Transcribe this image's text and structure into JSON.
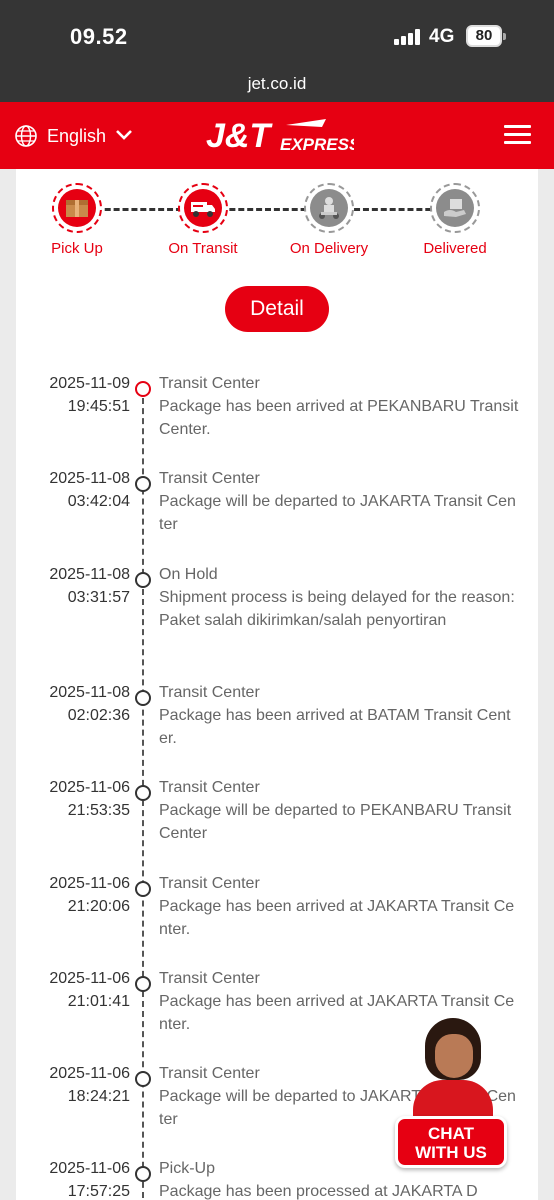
{
  "status_bar": {
    "time": "09.52",
    "network": "4G",
    "battery": "80",
    "url": "jet.co.id"
  },
  "header": {
    "language": "English",
    "logo_main": "J&T",
    "logo_sub": "EXPRESS"
  },
  "steps": [
    {
      "label": "Pick Up",
      "state": "done"
    },
    {
      "label": "On Transit",
      "state": "done"
    },
    {
      "label": "On Delivery",
      "state": "pending"
    },
    {
      "label": "Delivered",
      "state": "pending"
    }
  ],
  "detail_button": "Detail",
  "events": [
    {
      "date": "2025-11-09",
      "time": "19:45:51",
      "status": "Transit Center",
      "description": "Package has been arrived at PEKANBARU Transit Center."
    },
    {
      "date": "2025-11-08",
      "time": "03:42:04",
      "status": "Transit Center",
      "description": "Package will be departed to JAKARTA Transit Center"
    },
    {
      "date": "2025-11-08",
      "time": "03:31:57",
      "status": "On Hold",
      "description": "Shipment process is being delayed for the reason: Paket salah dikirimkan/salah penyortiran"
    },
    {
      "date": "2025-11-08",
      "time": "02:02:36",
      "status": "Transit Center",
      "description": "Package has been arrived at BATAM Transit Center."
    },
    {
      "date": "2025-11-06",
      "time": "21:53:35",
      "status": "Transit Center",
      "description": "Package will be departed to PEKANBARU Transit Center"
    },
    {
      "date": "2025-11-06",
      "time": "21:20:06",
      "status": "Transit Center",
      "description": "Package has been arrived at JAKARTA Transit Center."
    },
    {
      "date": "2025-11-06",
      "time": "21:01:41",
      "status": "Transit Center",
      "description": "Package has been arrived at JAKARTA Transit Center."
    },
    {
      "date": "2025-11-06",
      "time": "18:24:21",
      "status": "Transit Center",
      "description": "Package will be departed to JAKARTA Transit Center"
    },
    {
      "date": "2025-11-06",
      "time": "17:57:25",
      "status": "Pick-Up",
      "description": "Package has been processed at JAKARTA D"
    }
  ],
  "chat": {
    "line1": "CHAT",
    "line2": "WITH US"
  },
  "colors": {
    "brand_red": "#e60012",
    "status_bar": "#353535",
    "background": "#ebebeb"
  }
}
